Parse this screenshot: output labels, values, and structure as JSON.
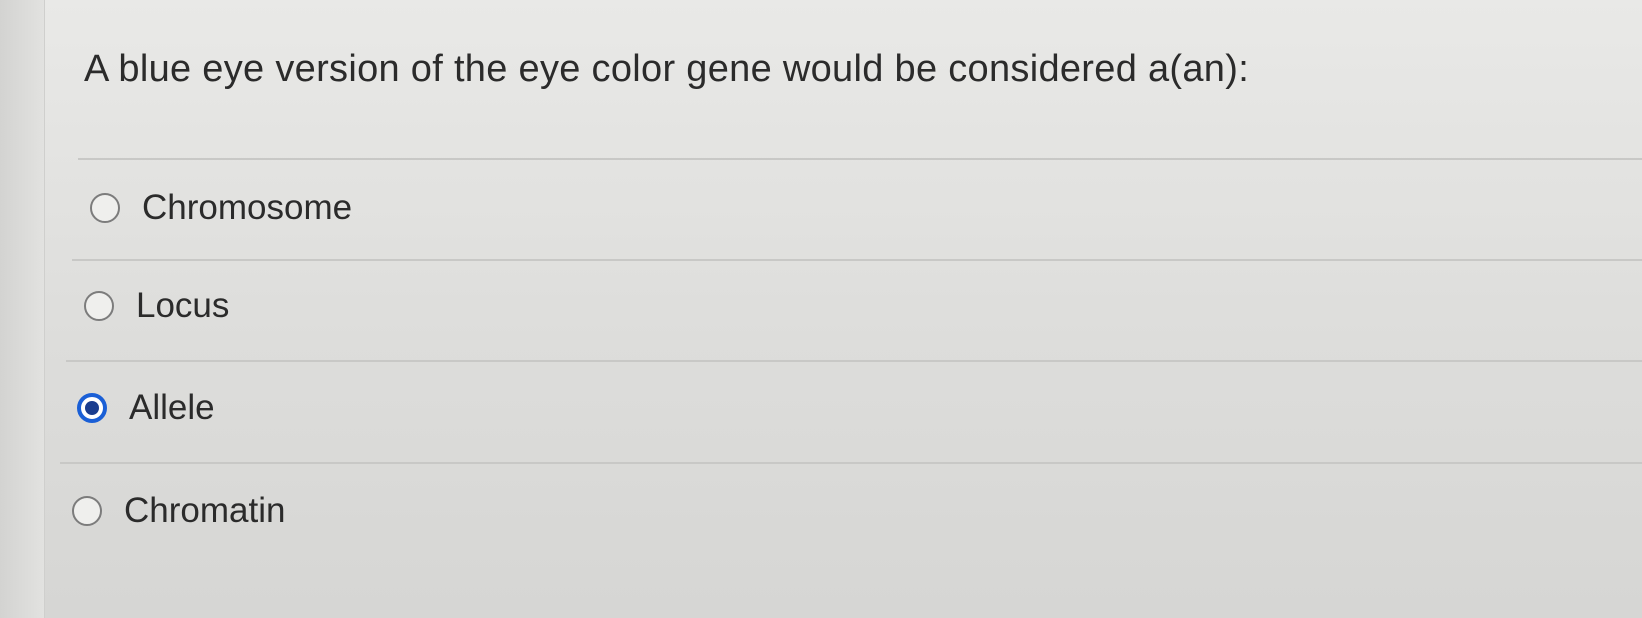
{
  "question": {
    "text": "A blue eye version of the eye color gene would be considered a(an):"
  },
  "options": [
    {
      "label": "Chromosome",
      "selected": false
    },
    {
      "label": "Locus",
      "selected": false
    },
    {
      "label": "Allele",
      "selected": true
    },
    {
      "label": "Chromatin",
      "selected": false
    }
  ],
  "colors": {
    "selected_radio": "#1a5fd6",
    "background": "#e2e2e0",
    "text": "#2b2b2b"
  }
}
